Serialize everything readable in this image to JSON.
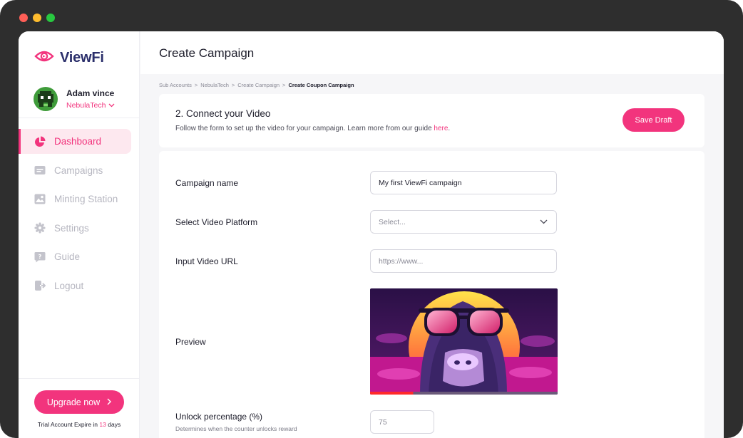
{
  "brand": {
    "name": "ViewFi",
    "accent": "#f2347d",
    "navy": "#2b2f6b"
  },
  "user": {
    "name": "Adam vince",
    "org": "NebulaTech"
  },
  "nav": [
    {
      "label": "Dashboard",
      "icon": "pie-chart-icon",
      "active": true
    },
    {
      "label": "Campaigns",
      "icon": "campaign-card-icon",
      "active": false
    },
    {
      "label": "Minting Station",
      "icon": "image-icon",
      "active": false
    },
    {
      "label": "Settings",
      "icon": "gear-icon",
      "active": false
    },
    {
      "label": "Guide",
      "icon": "help-icon",
      "active": false
    },
    {
      "label": "Logout",
      "icon": "logout-icon",
      "active": false
    }
  ],
  "upgrade": {
    "label": "Upgrade now",
    "trial_prefix": "Trial Account Expire in",
    "trial_days": "13",
    "trial_suffix": "days"
  },
  "header": {
    "title": "Create Campaign"
  },
  "breadcrumb": [
    "Sub Accounts",
    "NebulaTech",
    "Create Campaign",
    "Create Coupon Campaign"
  ],
  "step": {
    "title": "2. Connect your Video",
    "desc": "Follow the form to set up the video for your campaign. Learn more from our guide",
    "link": "here",
    "save_label": "Save Draft"
  },
  "form": {
    "campaign_name_label": "Campaign name",
    "campaign_name_value": "My first ViewFi campaign",
    "platform_label": "Select Video Platform",
    "platform_placeholder": "Select...",
    "url_label": "Input Video URL",
    "url_placeholder": "https://www...",
    "preview_label": "Preview",
    "preview_progress": 0.23,
    "unlock_label": "Unlock percentage (%)",
    "unlock_sublabel": "Determines when the counter unlocks reward",
    "unlock_placeholder": "75"
  }
}
